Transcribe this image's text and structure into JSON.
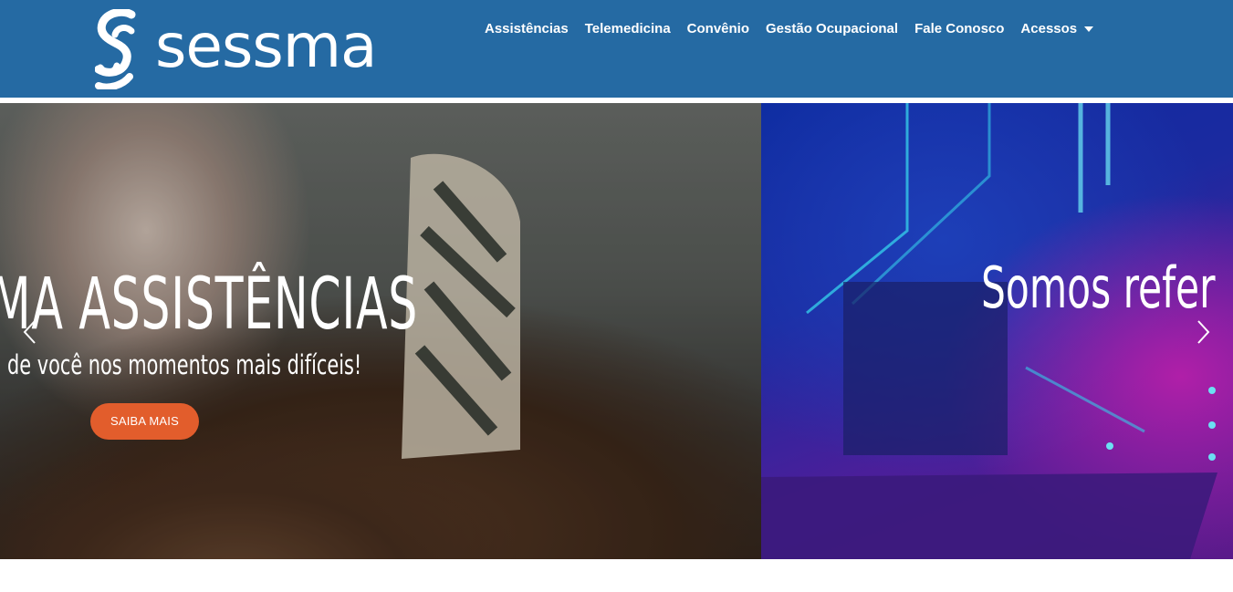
{
  "brand": {
    "name": "sessma"
  },
  "nav": {
    "items": [
      {
        "label": "Assistências"
      },
      {
        "label": "Telemedicina"
      },
      {
        "label": "Convênio"
      },
      {
        "label": "Gestão Ocupacional"
      },
      {
        "label": "Fale Conosco"
      },
      {
        "label": "Acessos",
        "has_dropdown": true,
        "icon": "caret-down-icon"
      }
    ]
  },
  "slider": {
    "slides": [
      {
        "title": "MA ASSISTÊNCIAS",
        "subtitle": "de você nos momentos mais difíceis!",
        "button_label": "SAIBA MAIS"
      },
      {
        "title": "Somos refer"
      }
    ],
    "prev_icon": "chevron-left-icon",
    "next_icon": "chevron-right-icon"
  },
  "colors": {
    "header_bg": "#256aa3",
    "button_bg": "#e25d2c",
    "text_on_dark": "#ffffff"
  }
}
